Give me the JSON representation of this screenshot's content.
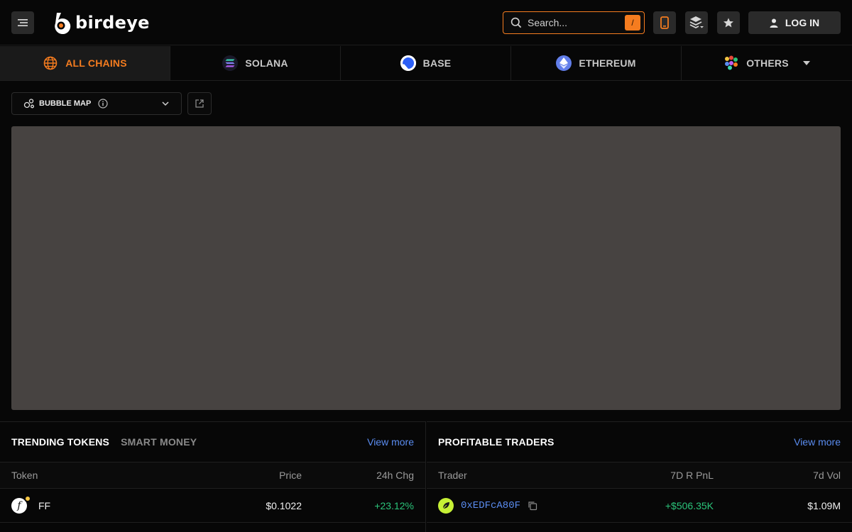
{
  "header": {
    "logo_text": "birdeye",
    "search_placeholder": "Search...",
    "search_shortcut": "/",
    "login_label": "LOG IN"
  },
  "chains": [
    {
      "label": "ALL CHAINS",
      "active": true,
      "icon": "globe-icon"
    },
    {
      "label": "SOLANA",
      "active": false,
      "icon": "solana-icon"
    },
    {
      "label": "BASE",
      "active": false,
      "icon": "base-icon"
    },
    {
      "label": "ETHEREUM",
      "active": false,
      "icon": "ethereum-icon"
    },
    {
      "label": "OTHERS",
      "active": false,
      "icon": "others-icon"
    }
  ],
  "bubble_map": {
    "label": "BUBBLE MAP"
  },
  "trending": {
    "tabs": [
      "TRENDING TOKENS",
      "SMART MONEY"
    ],
    "view_more": "View more",
    "columns": [
      "Token",
      "Price",
      "24h Chg"
    ],
    "rows": [
      {
        "token": "FF",
        "price": "$0.1022",
        "change": "+23.12%"
      }
    ]
  },
  "traders": {
    "title": "PROFITABLE TRADERS",
    "view_more": "View more",
    "columns": [
      "Trader",
      "7D R PnL",
      "7d Vol"
    ],
    "rows": [
      {
        "trader": "0xEDFcA80F",
        "pnl": "+$506.35K",
        "volume": "$1.09M"
      }
    ]
  },
  "colors": {
    "accent": "#f57c1f",
    "link": "#5a8cf0",
    "positive": "#2bc47a",
    "map_bg": "#474341"
  }
}
